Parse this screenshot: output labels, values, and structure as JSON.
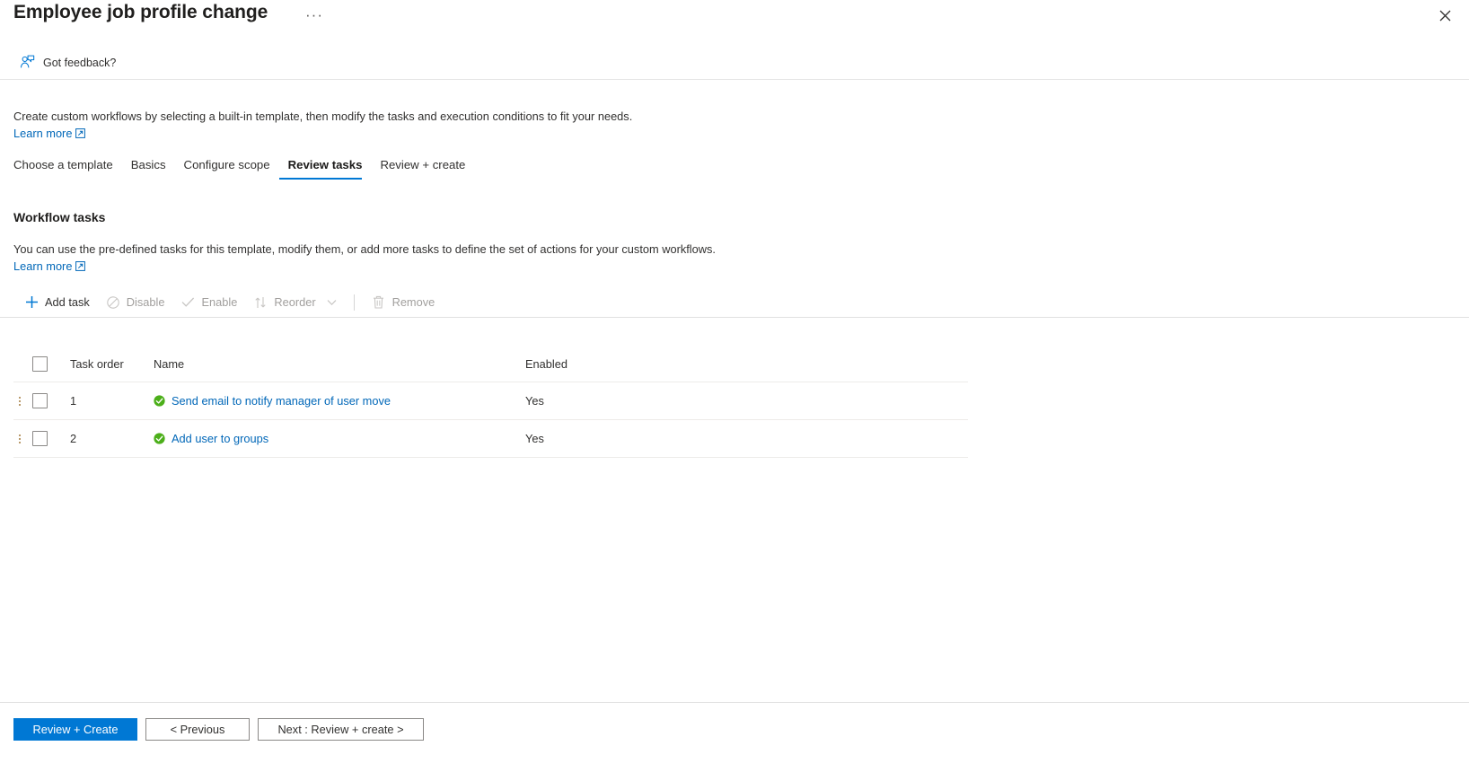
{
  "header": {
    "title": "Employee job profile change",
    "ellipsis_label": "···",
    "close_label": "Close",
    "close_icon": "close-icon"
  },
  "feedback": {
    "label": "Got feedback?",
    "icon": "feedback-person-icon"
  },
  "intro": {
    "text": "Create custom workflows by selecting a built-in template, then modify the tasks and execution conditions to fit your needs.",
    "learn_more": "Learn more",
    "external_icon": "external-link-icon"
  },
  "tabs": [
    {
      "label": "Choose a template",
      "active": false
    },
    {
      "label": "Basics",
      "active": false
    },
    {
      "label": "Configure scope",
      "active": false
    },
    {
      "label": "Review tasks",
      "active": true
    },
    {
      "label": "Review + create",
      "active": false
    }
  ],
  "section": {
    "title": "Workflow tasks",
    "description": "You can use the pre-defined tasks for this template, modify them, or add more tasks to define the set of actions for your custom workflows.",
    "learn_more": "Learn more"
  },
  "toolbar": {
    "add_task": "Add task",
    "disable": "Disable",
    "enable": "Enable",
    "reorder": "Reorder",
    "remove": "Remove",
    "icons": {
      "add": "plus-icon",
      "disable": "block-circle-icon",
      "enable": "checkmark-icon",
      "reorder": "sort-arrows-icon",
      "reorder_chevron": "chevron-down-icon",
      "remove": "trash-icon"
    }
  },
  "table": {
    "columns": [
      "Task order",
      "Name",
      "Enabled"
    ],
    "rows": [
      {
        "order": "1",
        "name": "Send email to notify manager of user move",
        "enabled": "Yes",
        "status_icon": "check-circle-icon",
        "selected": false
      },
      {
        "order": "2",
        "name": "Add user to groups",
        "enabled": "Yes",
        "status_icon": "check-circle-icon",
        "selected": false
      }
    ]
  },
  "footer": {
    "primary": "Review + Create",
    "previous": "< Previous",
    "next": "Next : Review + create >"
  },
  "colors": {
    "accent": "#0078d4",
    "link": "#0067b8",
    "success": "#4caf1a",
    "text": "#323130",
    "disabled": "#a19f9d"
  }
}
